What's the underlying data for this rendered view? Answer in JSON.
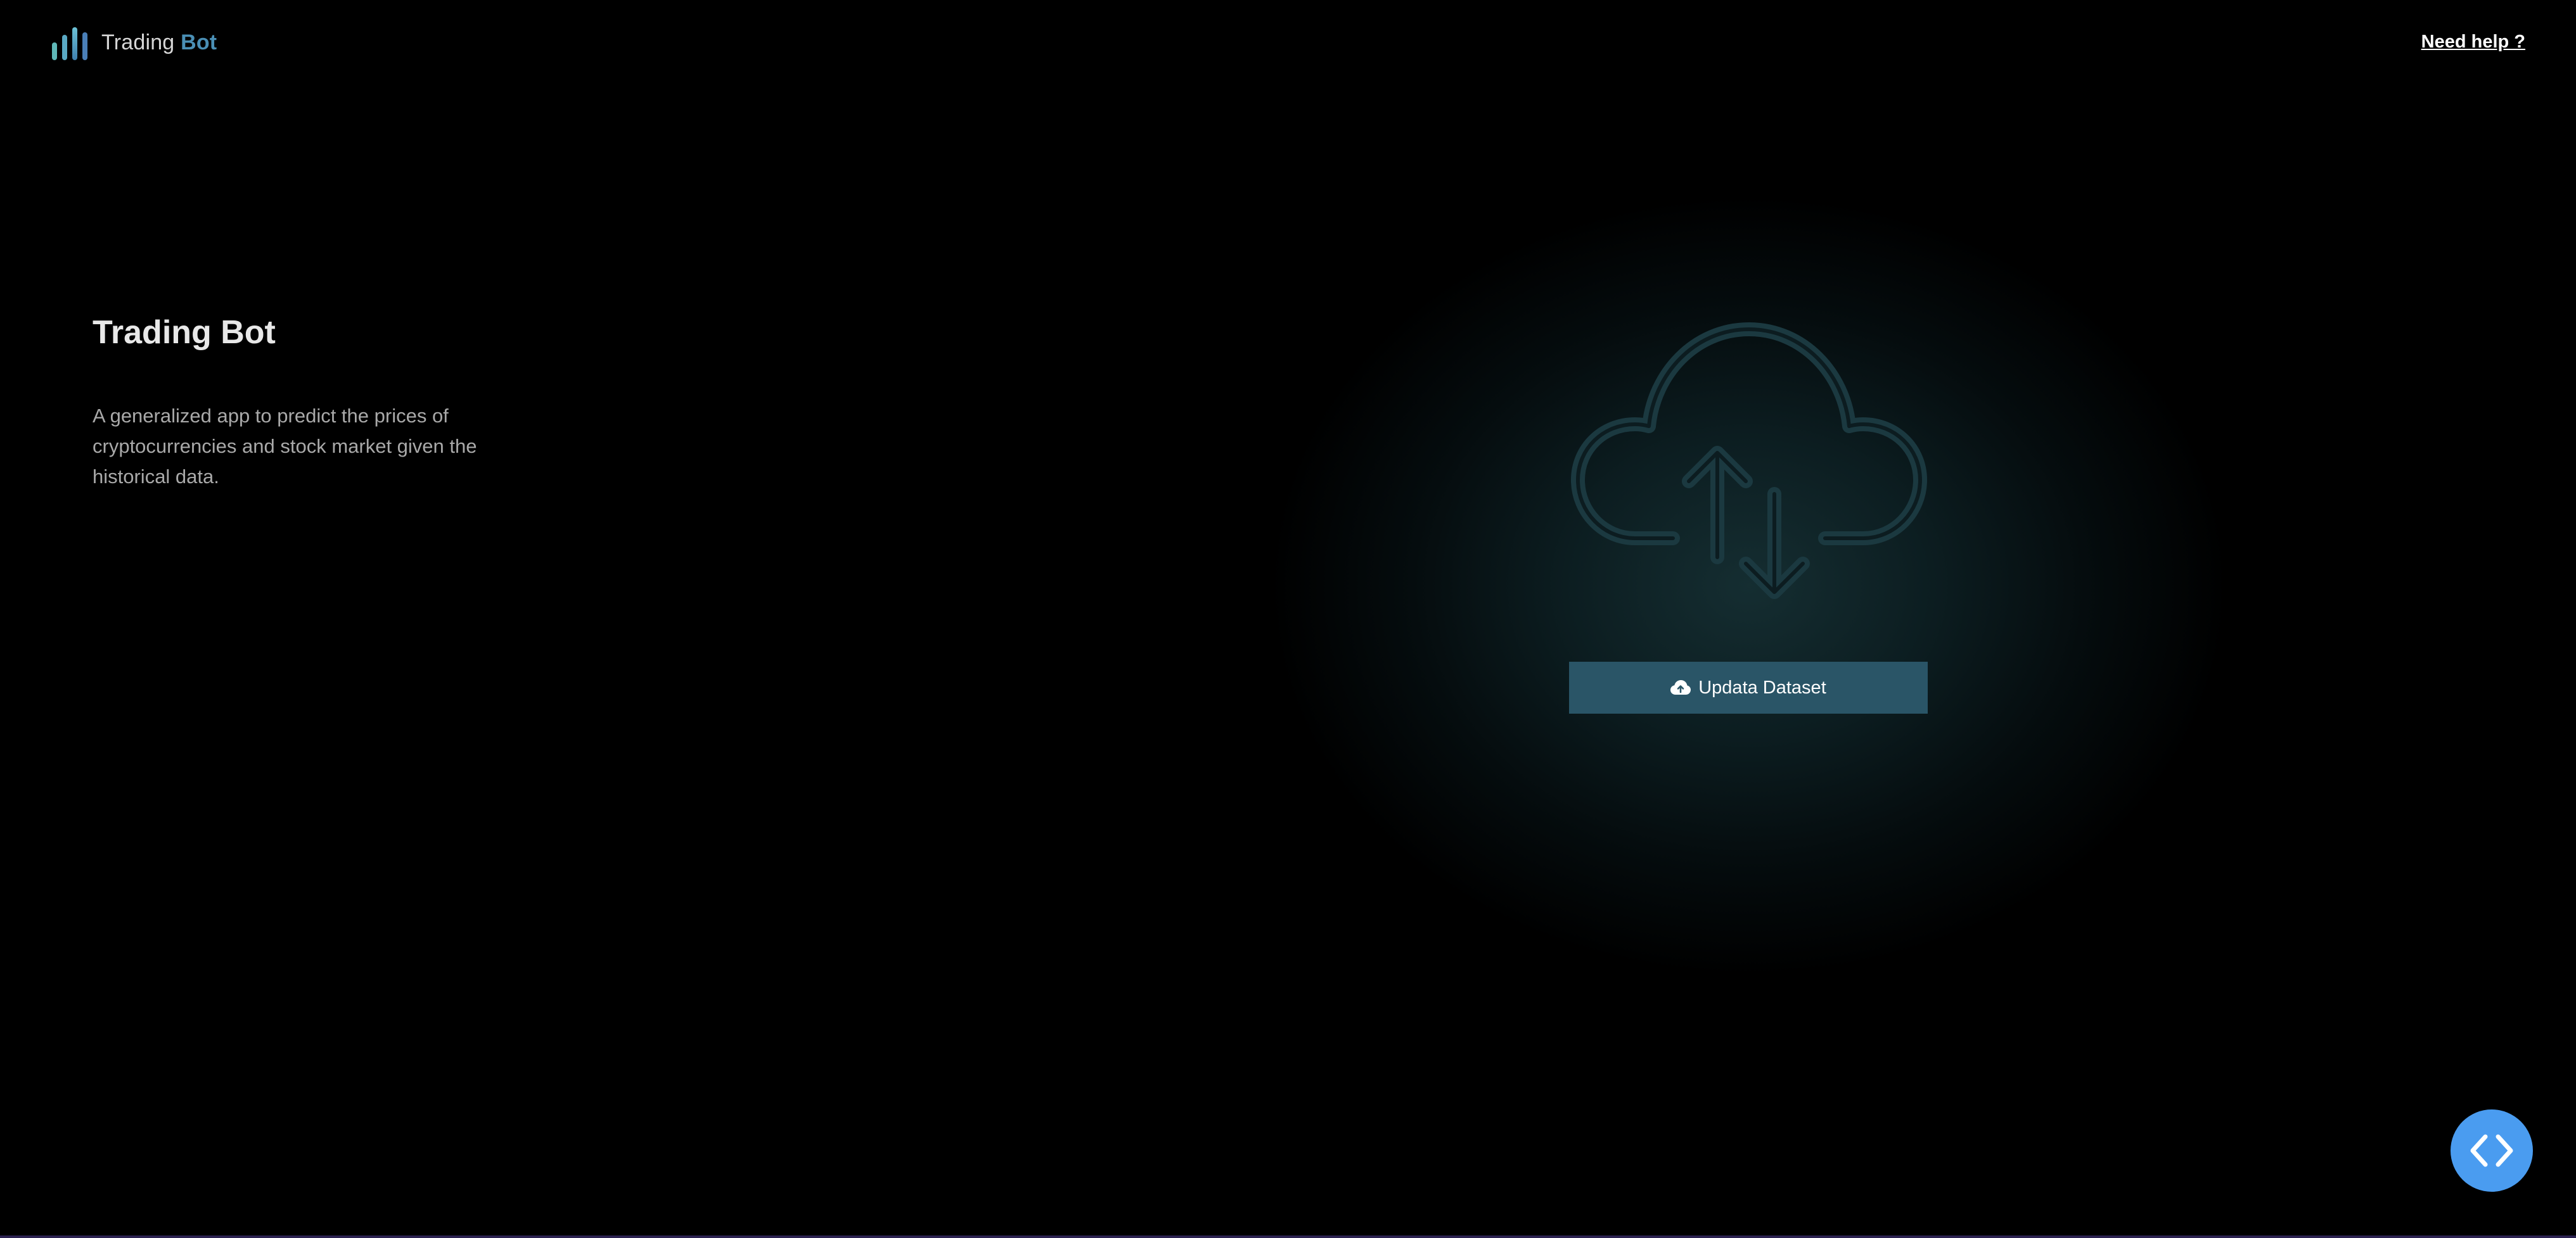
{
  "header": {
    "brand_prefix": "Trading",
    "brand_suffix": "Bot",
    "logo_icon": "bar-chart-logo-icon",
    "help_link": "Need help ?"
  },
  "hero": {
    "title": "Trading Bot",
    "description": "A generalized app to predict the prices of cryptocurrencies and stock market given the historical data."
  },
  "upload": {
    "illustration_icon": "cloud-upload-download-icon",
    "button_icon": "cloud-upload-icon",
    "button_label": "Updata Dataset"
  },
  "fab": {
    "icon": "code-brackets-icon"
  },
  "colors": {
    "background": "#000000",
    "accent": "#4a8fb5",
    "button": "#2a5567",
    "fab": "#4a9cf0",
    "illustration_stroke": "#1c3a40"
  }
}
